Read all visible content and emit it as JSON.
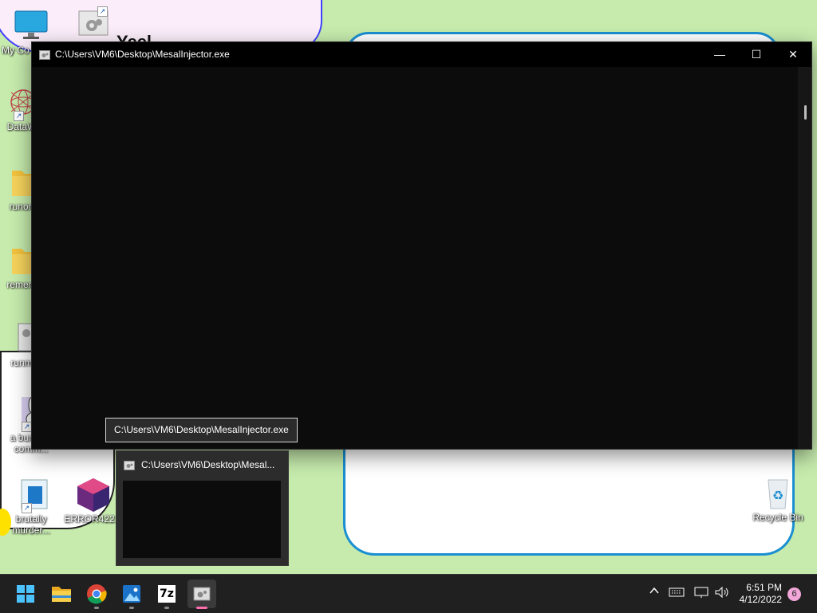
{
  "desktop": {
    "background_color": "#c6ebad",
    "icons": [
      {
        "label": "My Co",
        "icon": "monitor-icon"
      },
      {
        "label": "",
        "icon": "settings-app-icon"
      },
      {
        "label": "DataW",
        "icon": "wireframe-sphere-icon"
      },
      {
        "label": "runon",
        "icon": "folder-icon"
      },
      {
        "label": "remem",
        "icon": "folder-icon"
      },
      {
        "label": "runm",
        "icon": "app-window-icon"
      },
      {
        "label": "a bun has comm...",
        "icon": "bunny-icon"
      },
      {
        "label": "brutally murder...",
        "icon": "app-shortcut-icon"
      },
      {
        "label": "ERROR422...",
        "icon": "corrupted-cube-icon"
      },
      {
        "label": "Recycle Bin",
        "icon": "recycle-bin-icon"
      }
    ],
    "background_text": "Yeel"
  },
  "console": {
    "title": "C:\\Users\\VM6\\Desktop\\MesalInjector.exe",
    "minimize": "—",
    "maximize": "☐",
    "close": "✕",
    "background": "#0c0c0c"
  },
  "tooltip": {
    "text": "C:\\Users\\VM6\\Desktop\\MesalInjector.exe"
  },
  "preview": {
    "title": "C:\\Users\\VM6\\Desktop\\Mesal..."
  },
  "taskbar": {
    "apps": [
      {
        "name": "start",
        "icon": "windows-start-icon"
      },
      {
        "name": "file-explorer",
        "icon": "folder-icon"
      },
      {
        "name": "chrome",
        "icon": "chrome-icon"
      },
      {
        "name": "photos",
        "icon": "photos-icon"
      },
      {
        "name": "7zip",
        "icon": "7zip-icon",
        "label": "7z"
      },
      {
        "name": "mesalinjector",
        "icon": "console-app-icon",
        "active": true
      }
    ],
    "tray": {
      "chevron": "^",
      "time": "6:51 PM",
      "date": "4/12/2022",
      "notifications": "6"
    }
  }
}
